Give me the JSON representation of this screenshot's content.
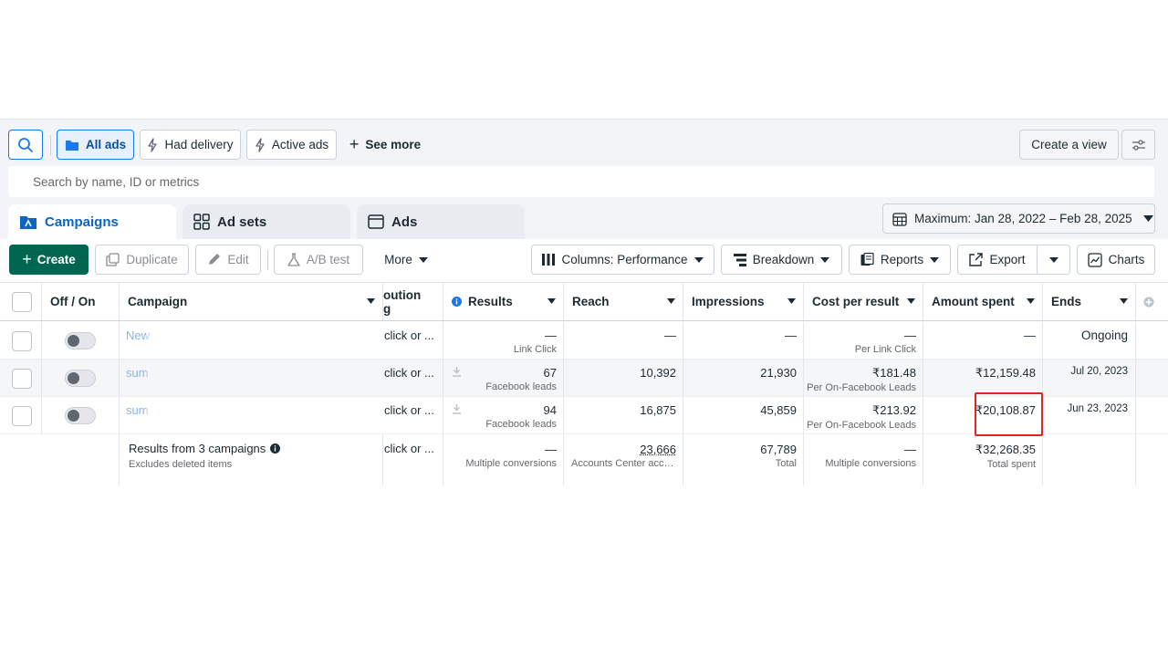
{
  "filters": {
    "all_ads": "All ads",
    "had_delivery": "Had delivery",
    "active_ads": "Active ads",
    "see_more": "See more",
    "create_view": "Create a view"
  },
  "search": {
    "placeholder": "Search by name, ID or metrics"
  },
  "tabs": [
    {
      "label": "Campaigns",
      "active": true
    },
    {
      "label": "Ad sets",
      "active": false
    },
    {
      "label": "Ads",
      "active": false
    }
  ],
  "date_range": "Maximum: Jan 28, 2022 – Feb 28, 2025",
  "toolbar": {
    "create": "Create",
    "duplicate": "Duplicate",
    "edit": "Edit",
    "ab_test": "A/B test",
    "more": "More",
    "columns": "Columns: Performance",
    "breakdown": "Breakdown",
    "reports": "Reports",
    "export": "Export",
    "charts": "Charts"
  },
  "table": {
    "headers": {
      "off_on": "Off / On",
      "campaign": "Campaign",
      "attribution_1": "oution",
      "attribution_2": "g",
      "results": "Results",
      "reach": "Reach",
      "impressions": "Impressions",
      "cost_per_result": "Cost per result",
      "amount_spent": "Amount spent",
      "ends": "Ends"
    },
    "rows": [
      {
        "name": "New",
        "attribution": "click or ...",
        "results": "—",
        "results_sub": "Link Click",
        "reach": "—",
        "impressions": "—",
        "cost": "—",
        "cost_sub": "Per Link Click",
        "spent": "—",
        "ends": "Ongoing"
      },
      {
        "name": "sum",
        "attribution": "click or ...",
        "results": "67",
        "results_sub": "Facebook leads",
        "reach": "10,392",
        "impressions": "21,930",
        "cost": "₹181.48",
        "cost_sub": "Per On-Facebook Leads",
        "spent": "₹12,159.48",
        "ends": "Jul 20, 2023"
      },
      {
        "name": "sum",
        "attribution": "click or ...",
        "results": "94",
        "results_sub": "Facebook leads",
        "reach": "16,875",
        "impressions": "45,859",
        "cost": "₹213.92",
        "cost_sub": "Per On-Facebook Leads",
        "spent": "₹20,108.87",
        "ends": "Jun 23, 2023"
      }
    ],
    "summary": {
      "title": "Results from 3 campaigns",
      "subtitle": "Excludes deleted items",
      "attribution": "click or ...",
      "results": "—",
      "results_sub": "Multiple conversions",
      "reach": "23,666",
      "reach_sub": "Accounts Center acco...",
      "impressions": "67,789",
      "impressions_sub": "Total",
      "cost": "—",
      "cost_sub": "Multiple conversions",
      "spent": "₹32,268.35",
      "spent_sub": "Total spent"
    }
  },
  "colors": {
    "accent": "#1877f2",
    "create_green": "#00664f",
    "highlight_red": "#e02424"
  }
}
